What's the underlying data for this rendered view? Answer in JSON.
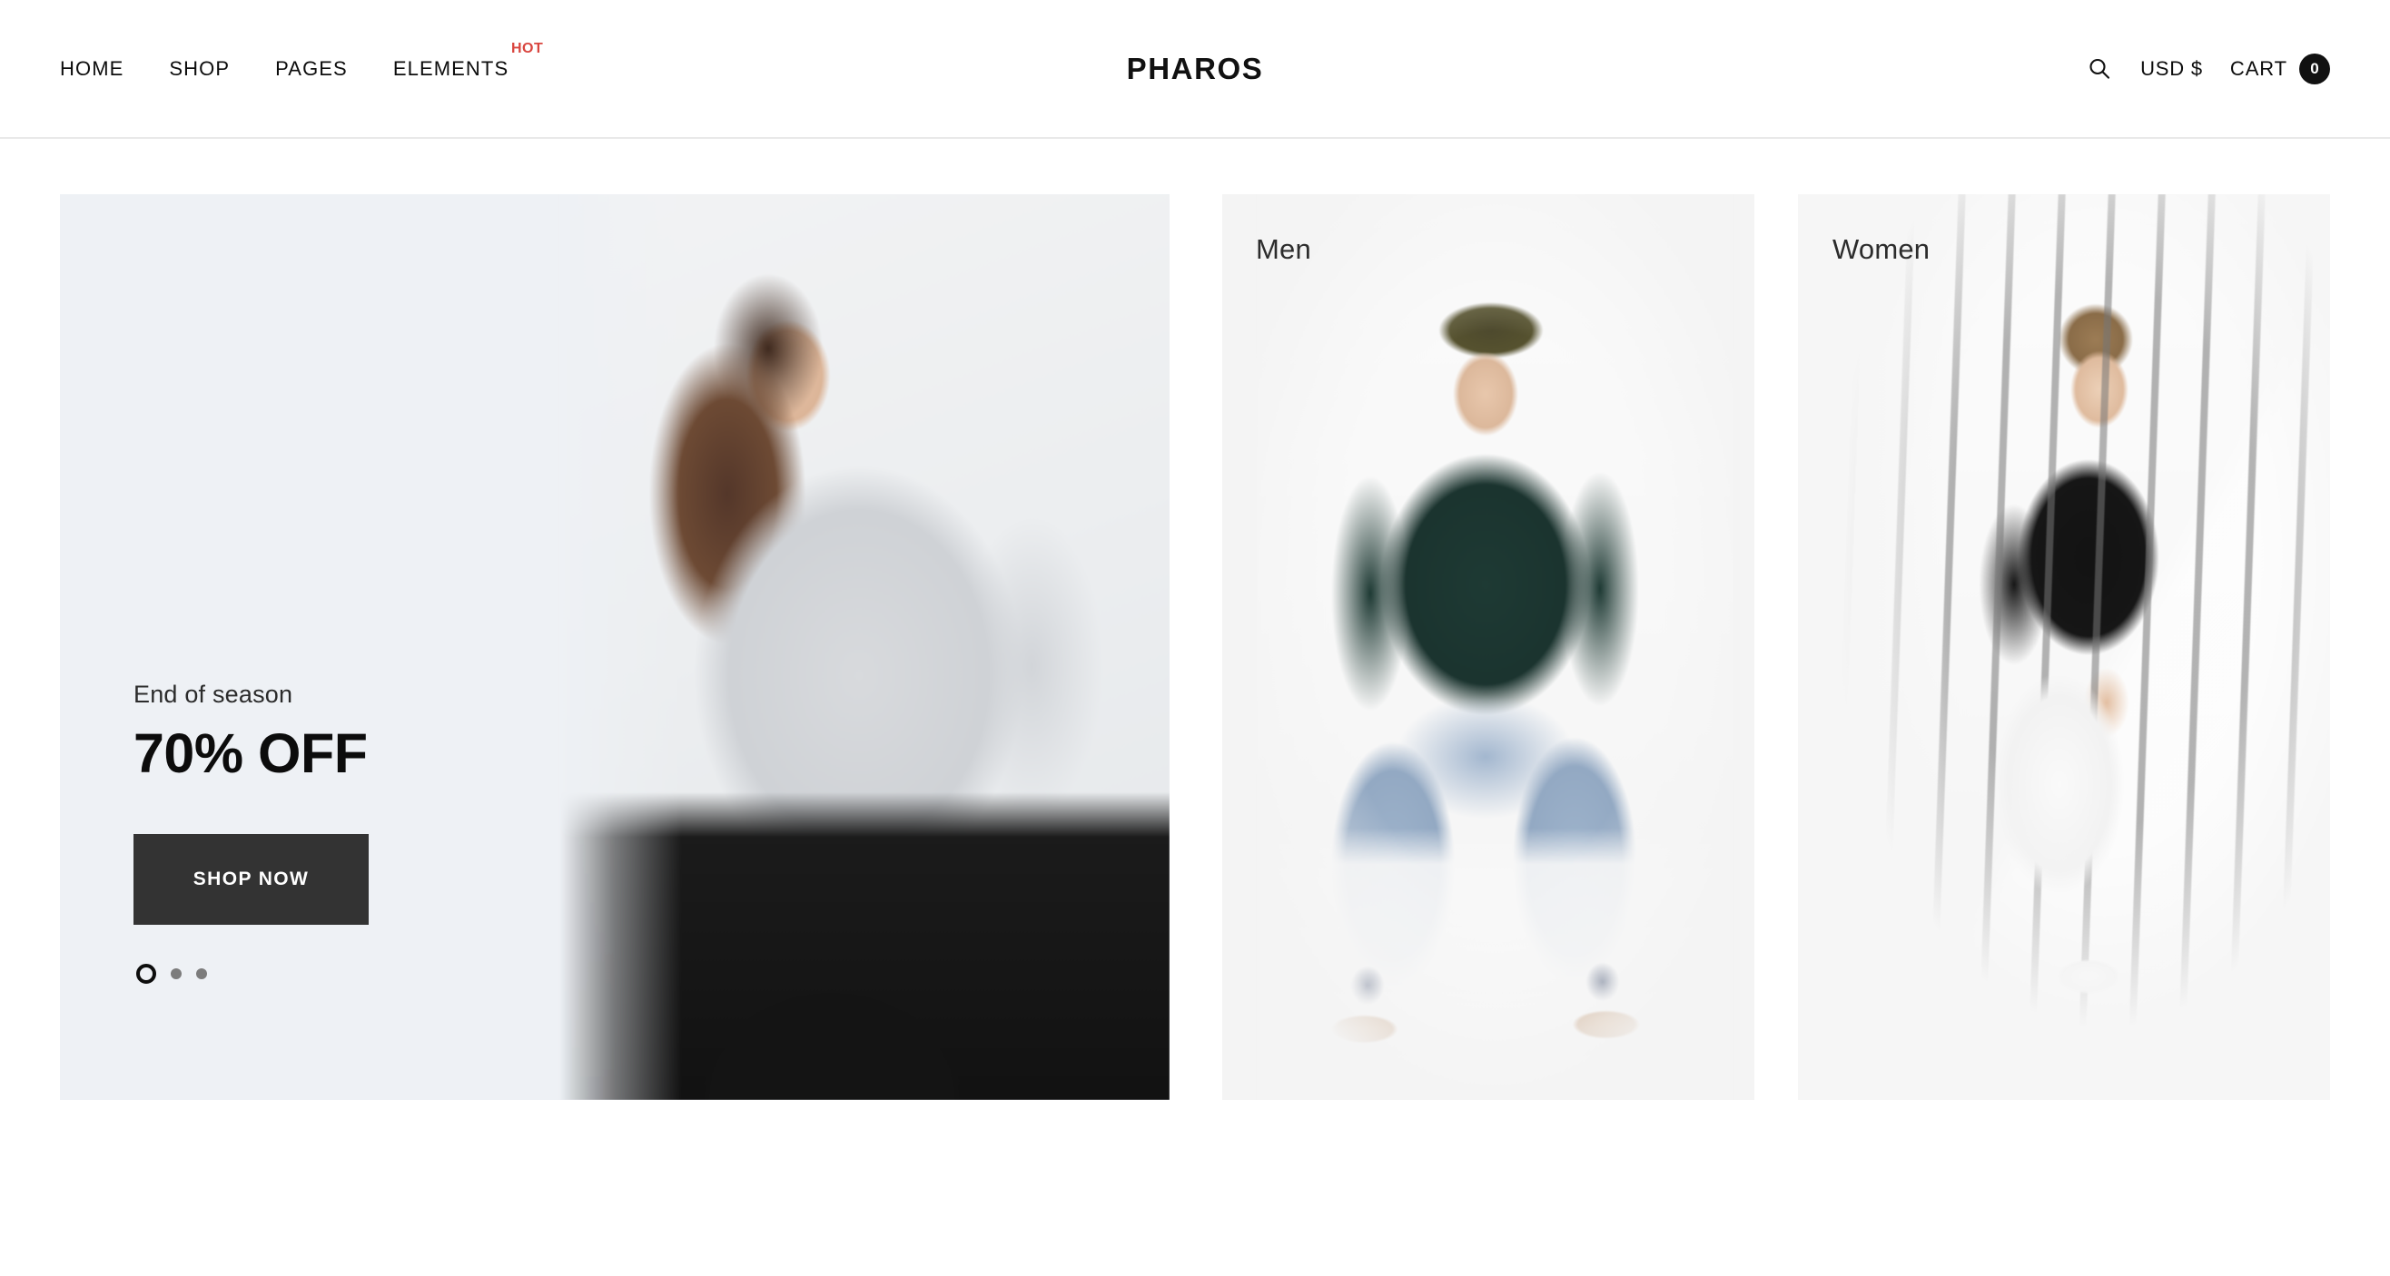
{
  "header": {
    "nav": [
      {
        "label": "HOME"
      },
      {
        "label": "SHOP"
      },
      {
        "label": "PAGES"
      },
      {
        "label": "ELEMENTS",
        "badge": "HOT"
      }
    ],
    "logo": "PHAROS",
    "search_icon": "search-icon",
    "currency": "USD $",
    "cart_label": "CART",
    "cart_count": "0",
    "badge_color": "#d9453f",
    "cart_badge_color": "#111111"
  },
  "hero": {
    "eyebrow": "End of season",
    "headline": "70% OFF",
    "cta_label": "SHOP NOW",
    "cta_bg": "#333333",
    "background": "#eef1f5",
    "slides": 3,
    "active_slide": 1,
    "dots": [
      {
        "active": true
      },
      {
        "active": false
      },
      {
        "active": false
      }
    ]
  },
  "categories": [
    {
      "label": "Men",
      "background": "#f4f4f4"
    },
    {
      "label": "Women",
      "background": "#f6f6f6"
    }
  ]
}
